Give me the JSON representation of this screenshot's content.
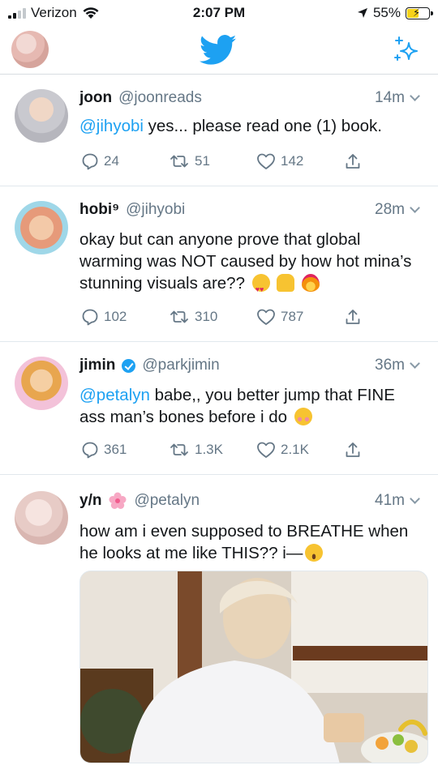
{
  "status_bar": {
    "carrier": "Verizon",
    "time": "2:07 PM",
    "battery_percent": "55%",
    "battery_level": 0.55
  },
  "header": {
    "logo_icon": "twitter-bird-icon",
    "compose_icon": "sparkle-icon"
  },
  "colors": {
    "accent": "#1da1f2",
    "text": "#14171a",
    "muted": "#657786"
  },
  "tweets": [
    {
      "name": "joon",
      "handle": "@joonreads",
      "time": "14m",
      "mention": "@jihyobi",
      "text": " yes... please read one (1) book.",
      "replies": "24",
      "retweets": "51",
      "likes": "142"
    },
    {
      "name": "hobi⁹",
      "handle": "@jihyobi",
      "time": "28m",
      "text": "okay but can anyone prove that global warming was NOT caused by how hot mina’s stunning visuals are??",
      "emojis": [
        "heart-eyes-emoji",
        "raised-hands-emoji",
        "fire-emoji"
      ],
      "replies": "102",
      "retweets": "310",
      "likes": "787"
    },
    {
      "name": "jimin",
      "handle": "@parkjimin",
      "time": "36m",
      "mention": "@petalyn",
      "text": " babe,, you better jump that FINE ass man’s bones before i do",
      "emojis": [
        "flushed-emoji"
      ],
      "replies": "361",
      "retweets": "1.3K",
      "likes": "2.1K"
    },
    {
      "name": "y/n",
      "handle": "@petalyn",
      "time": "41m",
      "text": "how am i even supposed to BREATHE when he looks at me like THIS?? i—",
      "emojis": [
        "weary-emoji"
      ]
    }
  ]
}
